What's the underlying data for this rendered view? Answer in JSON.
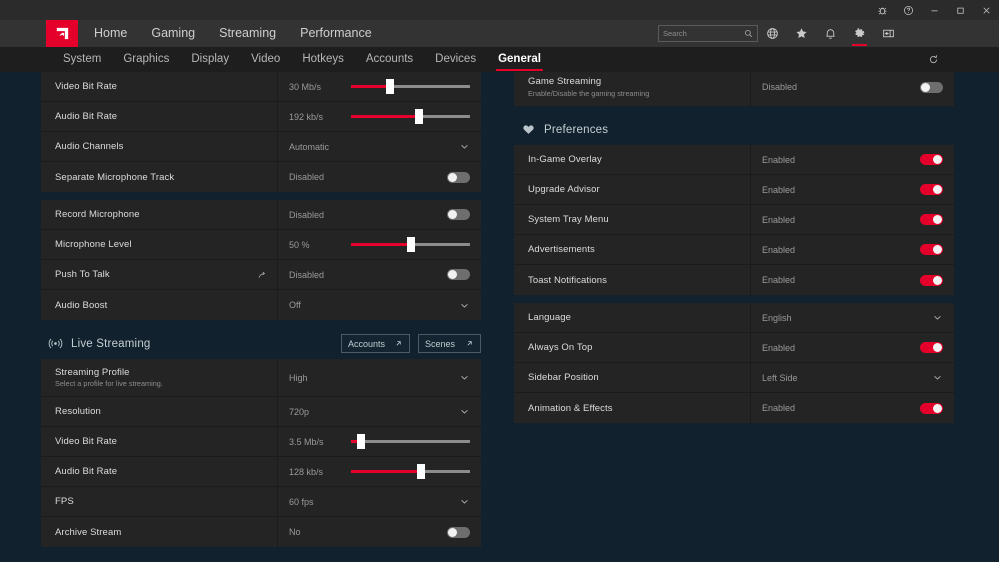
{
  "window": {
    "controls": [
      {
        "name": "bug-report-icon",
        "label": "Bug Report"
      },
      {
        "name": "help-icon",
        "label": "Help"
      },
      {
        "name": "minimize-icon",
        "label": "Minimize"
      },
      {
        "name": "maximize-icon",
        "label": "Maximize"
      },
      {
        "name": "close-icon",
        "label": "Close"
      }
    ]
  },
  "brand": {
    "name": "AMD Radeon Software",
    "accent": "#e4002b"
  },
  "nav": {
    "items": [
      {
        "label": "Home",
        "active": false
      },
      {
        "label": "Gaming",
        "active": false
      },
      {
        "label": "Streaming",
        "active": false
      },
      {
        "label": "Performance",
        "active": false
      }
    ],
    "search": {
      "placeholder": "Search",
      "value": ""
    },
    "icons": [
      {
        "name": "globe-icon",
        "active": false
      },
      {
        "name": "star-icon",
        "active": false
      },
      {
        "name": "bell-icon",
        "active": false
      },
      {
        "name": "gear-icon",
        "active": true
      },
      {
        "name": "panel-toggle-icon",
        "active": false
      }
    ]
  },
  "subnav": {
    "items": [
      {
        "label": "System",
        "active": false
      },
      {
        "label": "Graphics",
        "active": false
      },
      {
        "label": "Display",
        "active": false
      },
      {
        "label": "Video",
        "active": false
      },
      {
        "label": "Hotkeys",
        "active": false
      },
      {
        "label": "Accounts",
        "active": false
      },
      {
        "label": "Devices",
        "active": false
      },
      {
        "label": "General",
        "active": true
      }
    ],
    "reset_icon": "reset-icon"
  },
  "left_column": {
    "record_group": {
      "rows": [
        {
          "title": "Video Bit Rate",
          "sub": "",
          "value": "30 Mb/s",
          "control": "slider",
          "fill_pct": 33,
          "name": "video-bit-rate"
        },
        {
          "title": "Audio Bit Rate",
          "sub": "",
          "value": "192 kb/s",
          "control": "slider",
          "fill_pct": 57,
          "name": "audio-bit-rate"
        },
        {
          "title": "Audio Channels",
          "sub": "",
          "value": "Automatic",
          "control": "dropdown",
          "name": "audio-channels"
        },
        {
          "title": "Separate Microphone Track",
          "sub": "",
          "value": "Disabled",
          "control": "toggle",
          "on": false,
          "name": "separate-microphone-track"
        }
      ]
    },
    "microphone_group": {
      "rows": [
        {
          "title": "Record Microphone",
          "sub": "",
          "value": "Disabled",
          "control": "toggle",
          "on": false,
          "name": "record-microphone"
        },
        {
          "title": "Microphone Level",
          "sub": "",
          "value": "50 %",
          "control": "slider",
          "fill_pct": 50,
          "name": "microphone-level"
        },
        {
          "title": "Push To Talk",
          "sub": "",
          "value": "Disabled",
          "control": "toggle",
          "on": false,
          "ext_icon": "external-link-icon",
          "name": "push-to-talk"
        },
        {
          "title": "Audio Boost",
          "sub": "",
          "value": "Off",
          "control": "dropdown",
          "name": "audio-boost"
        }
      ]
    },
    "live_streaming": {
      "icon": "broadcast-icon",
      "title": "Live Streaming",
      "actions": [
        {
          "label": "Accounts",
          "icon": "external-arrow-icon",
          "name": "accounts-button"
        },
        {
          "label": "Scenes",
          "icon": "external-arrow-icon",
          "name": "scenes-button"
        }
      ],
      "rows": [
        {
          "title": "Streaming Profile",
          "sub": "Select a profile for live streaming.",
          "value": "High",
          "control": "dropdown",
          "name": "streaming-profile"
        },
        {
          "title": "Resolution",
          "sub": "",
          "value": "720p",
          "control": "dropdown",
          "name": "stream-resolution"
        },
        {
          "title": "Video Bit Rate",
          "sub": "",
          "value": "3.5 Mb/s",
          "control": "slider",
          "fill_pct": 8,
          "name": "stream-video-bit-rate"
        },
        {
          "title": "Audio Bit Rate",
          "sub": "",
          "value": "128 kb/s",
          "control": "slider",
          "fill_pct": 59,
          "name": "stream-audio-bit-rate"
        },
        {
          "title": "FPS",
          "sub": "",
          "value": "60 fps",
          "control": "dropdown",
          "name": "stream-fps"
        },
        {
          "title": "Archive Stream",
          "sub": "",
          "value": "No",
          "control": "toggle",
          "on": false,
          "name": "archive-stream"
        }
      ]
    }
  },
  "right_column": {
    "top_group": {
      "rows": [
        {
          "title": "Game Streaming",
          "sub": "Enable/Disable the gaming streaming",
          "value": "Disabled",
          "control": "toggle",
          "on": false,
          "name": "game-streaming"
        }
      ]
    },
    "preferences": {
      "icon": "heart-icon",
      "title": "Preferences",
      "group_a": {
        "rows": [
          {
            "title": "In-Game Overlay",
            "sub": "",
            "value": "Enabled",
            "control": "toggle",
            "on": true,
            "name": "in-game-overlay"
          },
          {
            "title": "Upgrade Advisor",
            "sub": "",
            "value": "Enabled",
            "control": "toggle",
            "on": true,
            "name": "upgrade-advisor"
          },
          {
            "title": "System Tray Menu",
            "sub": "",
            "value": "Enabled",
            "control": "toggle",
            "on": true,
            "name": "system-tray-menu"
          },
          {
            "title": "Advertisements",
            "sub": "",
            "value": "Enabled",
            "control": "toggle",
            "on": true,
            "name": "advertisements"
          },
          {
            "title": "Toast Notifications",
            "sub": "",
            "value": "Enabled",
            "control": "toggle",
            "on": true,
            "name": "toast-notifications"
          }
        ]
      },
      "group_b": {
        "rows": [
          {
            "title": "Language",
            "sub": "",
            "value": "English",
            "control": "dropdown",
            "name": "language"
          },
          {
            "title": "Always On Top",
            "sub": "",
            "value": "Enabled",
            "control": "toggle",
            "on": true,
            "name": "always-on-top"
          },
          {
            "title": "Sidebar Position",
            "sub": "",
            "value": "Left Side",
            "control": "dropdown",
            "name": "sidebar-position"
          },
          {
            "title": "Animation & Effects",
            "sub": "",
            "value": "Enabled",
            "control": "toggle",
            "on": true,
            "name": "animation-and-effects"
          }
        ]
      }
    }
  }
}
